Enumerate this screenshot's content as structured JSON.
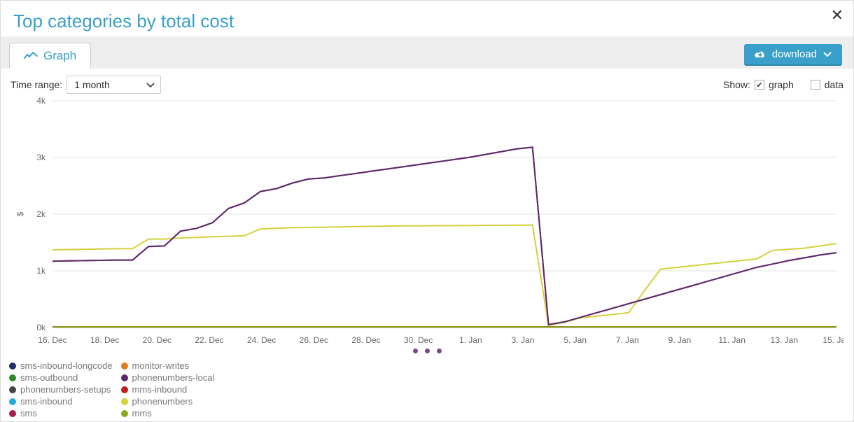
{
  "title": "Top categories by total cost",
  "tab_label": "Graph",
  "download_label": "download",
  "time_range_label": "Time range:",
  "time_range_value": "1 month",
  "show_label": "Show:",
  "show_graph_label": "graph",
  "show_data_label": "data",
  "show_graph_checked": true,
  "show_data_checked": false,
  "legend_col1": [
    {
      "name": "sms-inbound-longcode",
      "color": "#1f2d6b"
    },
    {
      "name": "sms-outbound",
      "color": "#2a8a2a"
    },
    {
      "name": "phonenumbers-setups",
      "color": "#444444"
    },
    {
      "name": "sms-inbound",
      "color": "#25a9df"
    },
    {
      "name": "sms",
      "color": "#a2214f"
    }
  ],
  "legend_col2": [
    {
      "name": "monitor-writes",
      "color": "#e07a1f"
    },
    {
      "name": "phonenumbers-local",
      "color": "#5a2b6e"
    },
    {
      "name": "mms-inbound",
      "color": "#c22020"
    },
    {
      "name": "phonenumbers",
      "color": "#d4d13c"
    },
    {
      "name": "mms",
      "color": "#8aa81f"
    }
  ],
  "chart_data": {
    "type": "line",
    "xlabel": "",
    "ylabel": "$",
    "ylim": [
      0,
      3300
    ],
    "y_ticks": [
      0,
      1000,
      2000,
      3000,
      4000
    ],
    "y_tick_labels": [
      "0k",
      "1k",
      "2k",
      "3k",
      "4k"
    ],
    "categories": [
      "16. Dec",
      "18. Dec",
      "20. Dec",
      "22. Dec",
      "24. Dec",
      "26. Dec",
      "28. Dec",
      "30. Dec",
      "1. Jan",
      "3. Jan",
      "5. Jan",
      "7. Jan",
      "9. Jan",
      "11. Jan",
      "13. Jan",
      "15. Jan"
    ],
    "series": [
      {
        "name": "sms",
        "color": "#a2214f",
        "values": [
          1170,
          1175,
          1180,
          1185,
          1190,
          1190,
          1430,
          1440,
          1700,
          1750,
          1850,
          2100,
          2200,
          2400,
          2450,
          2550,
          2620,
          2640,
          2680,
          2720,
          2760,
          2800,
          2840,
          2880,
          2920,
          2960,
          3000,
          3050,
          3100,
          3150,
          3180,
          50,
          100,
          180,
          260,
          340,
          420,
          500,
          580,
          660,
          740,
          820,
          900,
          980,
          1060,
          1120,
          1180,
          1230,
          1280,
          1320
        ]
      },
      {
        "name": "phonenumbers",
        "color": "#d4d13c",
        "values": [
          1370,
          1375,
          1380,
          1385,
          1390,
          1390,
          1560,
          1560,
          1580,
          1590,
          1600,
          1610,
          1620,
          1740,
          1750,
          1760,
          1765,
          1770,
          1775,
          1780,
          1785,
          1790,
          1792,
          1794,
          1796,
          1798,
          1800,
          1802,
          1804,
          1806,
          1808,
          40,
          90,
          170,
          200,
          230,
          260,
          650,
          1030,
          1060,
          1090,
          1120,
          1150,
          1180,
          1210,
          1360,
          1380,
          1400,
          1440,
          1480
        ]
      },
      {
        "name": "phonenumbers-local",
        "color": "#5a2b6e",
        "values": [
          1170,
          1175,
          1180,
          1185,
          1190,
          1190,
          1430,
          1440,
          1700,
          1750,
          1850,
          2100,
          2200,
          2400,
          2450,
          2550,
          2620,
          2640,
          2680,
          2720,
          2760,
          2800,
          2840,
          2880,
          2920,
          2960,
          3000,
          3050,
          3100,
          3150,
          3180,
          50,
          100,
          180,
          260,
          340,
          420,
          500,
          580,
          660,
          740,
          820,
          900,
          980,
          1060,
          1120,
          1180,
          1230,
          1280,
          1320
        ]
      },
      {
        "name": "sms-inbound-longcode",
        "color": "#1f2d6b",
        "values": "flat0"
      },
      {
        "name": "sms-outbound",
        "color": "#2a8a2a",
        "values": "flat0"
      },
      {
        "name": "phonenumbers-setups",
        "color": "#444444",
        "values": "flat0"
      },
      {
        "name": "sms-inbound",
        "color": "#25a9df",
        "values": "flat0"
      },
      {
        "name": "monitor-writes",
        "color": "#e07a1f",
        "values": "flat0"
      },
      {
        "name": "mms-inbound",
        "color": "#c22020",
        "values": "flat0"
      },
      {
        "name": "mms",
        "color": "#8aa81f",
        "values": "flat0"
      }
    ]
  }
}
